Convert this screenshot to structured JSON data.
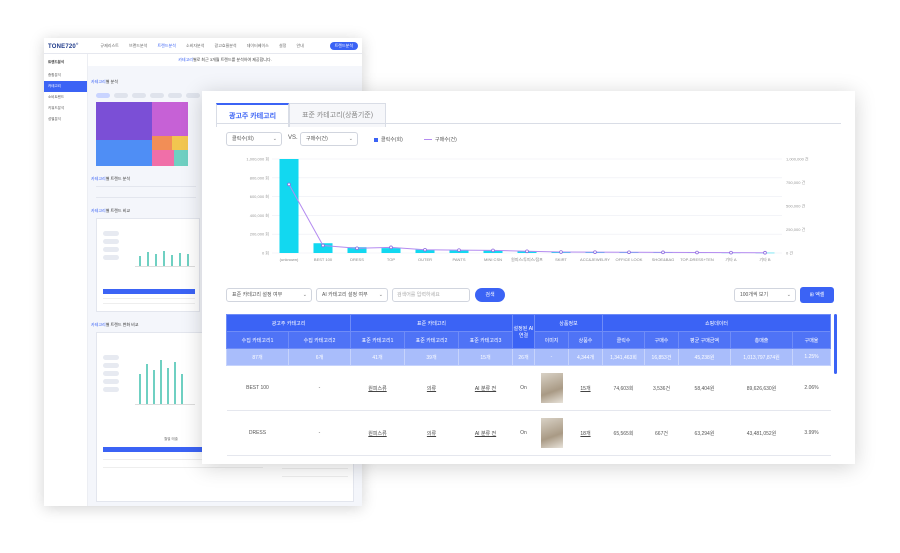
{
  "back": {
    "logo": "TONE720",
    "nav": [
      "규제리스트",
      "브랜드분석",
      "트렌드분석",
      "소비자분석",
      "광고효율분석",
      "데이터베이스",
      "설정",
      "안내"
    ],
    "cta": "트렌드분석",
    "sidebar_title": "트렌드분석",
    "sidebar_items": [
      "종합분석",
      "카테고리",
      "소비트렌드",
      "키워드분석",
      "성별분석"
    ],
    "banner_prefix": "카테고리",
    "banner_text": "별로 최근 3개월 트렌드를 분석하여 제공합니다.",
    "section1_hl": "카테고리",
    "section1": "별 분석",
    "section2_hl": "카테고리",
    "section2": "별 트렌드 분석",
    "section3_hl": "카테고리",
    "section3": "별 트렌드 비교",
    "section4_hl": "카테고리",
    "section4": "별 트렌드 변화 비교",
    "chart_title": "월별 매출"
  },
  "tabs": [
    "광고주 카테고리",
    "표준 카테고리(상품기준)"
  ],
  "controls": {
    "metric_a": "클릭수(회)",
    "vs": "VS.",
    "metric_b": "구매수(건)",
    "legend_a": "클릭수(회)",
    "legend_b": "구매수(건)",
    "filter1": "표준 카테고리 설정 여부",
    "filter2": "AI 카테고리 설정 여부",
    "search_placeholder": "검색어를 입력하세요",
    "search_btn": "검색",
    "page_size": "100개씩 보기",
    "excel_btn": "엑셀"
  },
  "chart_data": {
    "type": "bar",
    "categories": [
      "(unknown)",
      "BEST 100",
      "DRESS",
      "TOP",
      "OUTER",
      "PANTS",
      "MINI CSN",
      "원피스/투피스/점프",
      "SKIRT",
      "ACC&JEWELRY",
      "OFFICE LOOK",
      "SHOE&BAG",
      "TOP-DRESS+TEN",
      "기타 A",
      "기타 B"
    ],
    "series": [
      {
        "name": "클릭수(회)",
        "values": [
          1000000,
          104000,
          62000,
          52000,
          36000,
          30000,
          26000,
          20000,
          12000,
          9000,
          8000,
          6000,
          5000,
          4000,
          3000
        ]
      },
      {
        "name": "구매수(건)",
        "values": [
          730000,
          80000,
          50000,
          60000,
          34000,
          30000,
          28000,
          18000,
          10000,
          9000,
          8000,
          7000,
          5000,
          4000,
          3000
        ]
      }
    ],
    "y_ticks_left": [
      "1,000,000 회",
      "800,000 회",
      "600,000 회",
      "400,000 회",
      "200,000 회",
      "0 회"
    ],
    "y_ticks_right": [
      "1,000,000 건",
      "750,000 건",
      "500,000 건",
      "250,000 건",
      "0 건"
    ],
    "ylim": [
      0,
      1000000
    ],
    "y2lim": [
      0,
      1000000
    ]
  },
  "table": {
    "group_headers": [
      "광고주 카테고리",
      "표준 카테고리",
      "설정된 AI연결",
      "상품정보",
      "쇼핑데이터"
    ],
    "headers": [
      "수집 카테고리1",
      "수집 카테고리2",
      "표준 카테고리1",
      "표준 카테고리2",
      "표준 카테고리3",
      "",
      "이미지",
      "상품수",
      "클릭수",
      "구매수",
      "평균 구매금액",
      "총매출",
      "구매율"
    ],
    "summary": [
      "87개",
      "6개",
      "41개",
      "39개",
      "15개",
      "26개",
      "-",
      "4,344개",
      "1,341,463회",
      "16,853건",
      "45,238원",
      "1,013,797,874원",
      "1.25%"
    ],
    "rows": [
      [
        "BEST 100",
        "-",
        "원피스류",
        "의류",
        "AI 분류 전",
        "On",
        "",
        "15개",
        "74,603회",
        "3,536건",
        "58,404원",
        "89,626,630원",
        "2.06%"
      ],
      [
        "DRESS",
        "-",
        "원피스류",
        "의류",
        "AI 분류 전",
        "On",
        "",
        "18개",
        "65,565회",
        "667건",
        "63,294원",
        "43,481,052원",
        "3.99%"
      ]
    ]
  }
}
